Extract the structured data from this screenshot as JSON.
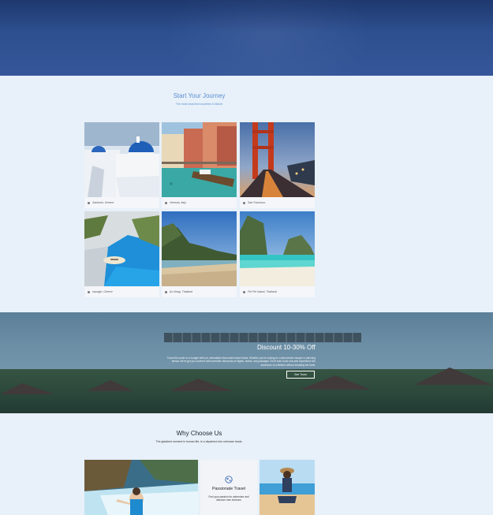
{
  "journey": {
    "title": "Start Your Journey",
    "subtitle": "The most searched countries in March",
    "destinations": [
      {
        "caption": "Santorini, Greece",
        "image": "santorini-photo"
      },
      {
        "caption": "Venezia, Italy",
        "image": "venice-photo"
      },
      {
        "caption": "San Francisco",
        "image": "golden-gate-photo"
      },
      {
        "caption": "navagio, Greece",
        "image": "navagio-photo"
      },
      {
        "caption": "Ao Nang, Thailand",
        "image": "ao-nang-photo"
      },
      {
        "caption": "Phi Phi Island, Thailand",
        "image": "phi-phi-photo"
      }
    ]
  },
  "discount": {
    "title": "Discount 10-30% Off",
    "text": "Travel the world on a budget with our unbeatable discounted travel deals. Whether you're looking for a last-minute escape or planning ahead, we've got you covered with incredible discounts on flights, hotels, and packages. Don't wait, book now and experience the adventure of a lifetime without breaking the bank.",
    "button": "See Tours"
  },
  "why": {
    "title": "Why Choose Us",
    "subtitle": "The gladdest moment in human life, is a departure into unknown lands.",
    "card_title": "Passionate Travel",
    "card_text": "Fuel your passion for adventure and discover new horizons",
    "icon": "globe-icon"
  },
  "colors": {
    "accent": "#5b8fd0",
    "hero": "#2d4f8f",
    "background": "#e8f0f9"
  }
}
